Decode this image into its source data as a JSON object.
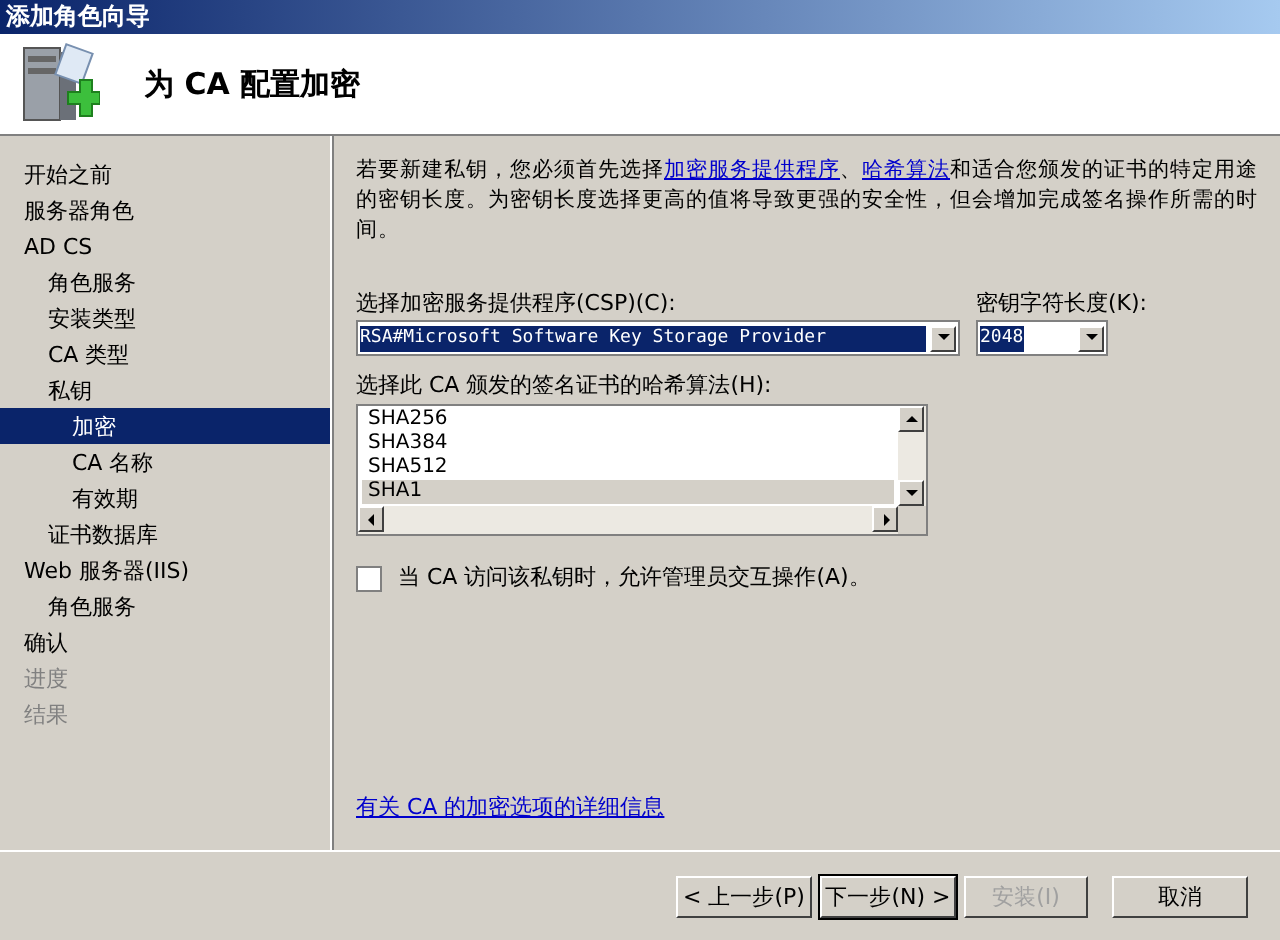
{
  "window": {
    "title": "添加角色向导"
  },
  "header": {
    "title": "为 CA 配置加密"
  },
  "sidebar": {
    "items": [
      {
        "label": "开始之前",
        "selected": false,
        "disabled": false
      },
      {
        "label": "服务器角色",
        "selected": false,
        "disabled": false
      },
      {
        "label": "AD CS",
        "selected": false,
        "disabled": false,
        "children": [
          {
            "label": "角色服务",
            "selected": false,
            "disabled": false
          },
          {
            "label": "安装类型",
            "selected": false,
            "disabled": false
          },
          {
            "label": "CA 类型",
            "selected": false,
            "disabled": false
          },
          {
            "label": "私钥",
            "selected": false,
            "disabled": false,
            "children": [
              {
                "label": "加密",
                "selected": true,
                "disabled": false
              },
              {
                "label": "CA 名称",
                "selected": false,
                "disabled": false
              },
              {
                "label": "有效期",
                "selected": false,
                "disabled": false
              }
            ]
          },
          {
            "label": "证书数据库",
            "selected": false,
            "disabled": false
          }
        ]
      },
      {
        "label": "Web 服务器(IIS)",
        "selected": false,
        "disabled": false,
        "children": [
          {
            "label": "角色服务",
            "selected": false,
            "disabled": false
          }
        ]
      },
      {
        "label": "确认",
        "selected": false,
        "disabled": false
      },
      {
        "label": "进度",
        "selected": false,
        "disabled": true
      },
      {
        "label": "结果",
        "selected": false,
        "disabled": true
      }
    ]
  },
  "description": [
    {
      "text": "若要新建私钥，您必须首先选择",
      "kind": "text"
    },
    {
      "text": "加密服务提供程序",
      "kind": "link"
    },
    {
      "text": "、",
      "kind": "text"
    },
    {
      "text": "哈希算法",
      "kind": "link"
    },
    {
      "text": "和适合您颁发的证书的特定用途的密钥长度。为密钥长度选择更高的值将导致更强的安全性，但会增加完成签名操作所需的时间。",
      "kind": "text"
    }
  ],
  "csp": {
    "label": "选择加密服务提供程序(CSP)(C):",
    "value": "RSA#Microsoft Software Key Storage Provider"
  },
  "key_length": {
    "label": "密钥字符长度(K):",
    "value": "2048"
  },
  "hash": {
    "label": "选择此 CA 颁发的签名证书的哈希算法(H):",
    "items": [
      {
        "label": "SHA256",
        "selected": false
      },
      {
        "label": "SHA384",
        "selected": false
      },
      {
        "label": "SHA512",
        "selected": false
      },
      {
        "label": "SHA1",
        "selected": true
      }
    ]
  },
  "allow_interaction": {
    "label": "当 CA 访问该私钥时，允许管理员交互操作(A)。",
    "checked": false
  },
  "help_link": "有关 CA 的加密选项的详细信息",
  "buttons": [
    {
      "label": "< 上一步(P)",
      "disabled": false,
      "default": false
    },
    {
      "label": "下一步(N) >",
      "disabled": false,
      "default": true
    },
    {
      "label": "安装(I)",
      "disabled": true,
      "default": false
    },
    {
      "label": "取消",
      "disabled": false,
      "default": false
    }
  ]
}
